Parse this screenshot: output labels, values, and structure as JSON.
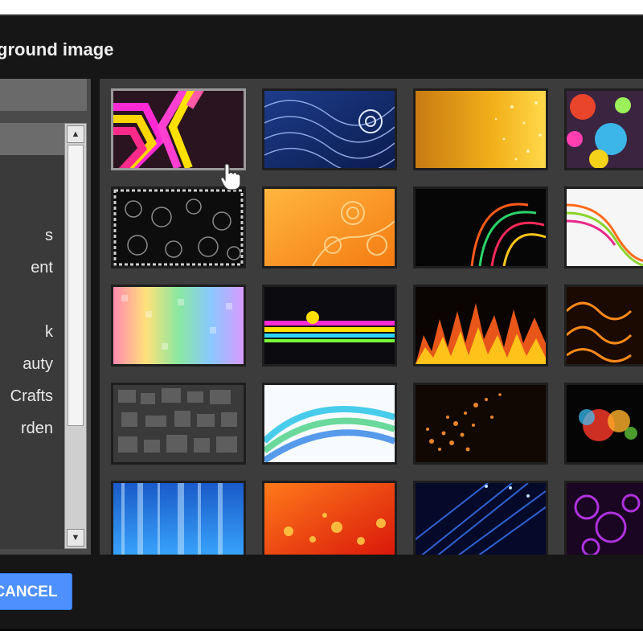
{
  "dialog": {
    "title": "ground image",
    "categories": [
      {
        "label": "",
        "selected": true
      },
      {
        "label": ""
      },
      {
        "label": ""
      },
      {
        "label": "s"
      },
      {
        "label": "ent"
      },
      {
        "label": ""
      },
      {
        "label": "k"
      },
      {
        "label": "auty"
      },
      {
        "label": "Crafts"
      },
      {
        "label": "rden"
      },
      {
        "label": ""
      },
      {
        "label": ""
      },
      {
        "label": ""
      }
    ],
    "cancel_label": "CANCEL"
  },
  "thumbnails": [
    {
      "name": "magenta-neon-stripes"
    },
    {
      "name": "blue-swirl-waves"
    },
    {
      "name": "gold-sparkle"
    },
    {
      "name": "colorful-graffiti"
    },
    {
      "name": "black-white-floral"
    },
    {
      "name": "orange-swirls"
    },
    {
      "name": "light-streaks-dark"
    },
    {
      "name": "rainbow-curves-white"
    },
    {
      "name": "rainbow-mosaic"
    },
    {
      "name": "retro-stripes-dark"
    },
    {
      "name": "flames"
    },
    {
      "name": "fire-smoke"
    },
    {
      "name": "gray-tiles"
    },
    {
      "name": "blue-green-waves"
    },
    {
      "name": "orange-particles"
    },
    {
      "name": "bokeh-lights-dark"
    },
    {
      "name": "blue-light-rays"
    },
    {
      "name": "red-orange-bokeh"
    },
    {
      "name": "blue-fiber-optics"
    },
    {
      "name": "purple-bubbles"
    }
  ],
  "colors": {
    "dialog_bg": "#161616",
    "panel_bg": "#3c3c3c",
    "accent_button": "#4d90fe"
  },
  "icons": {
    "cursor": "pointer-hand-icon",
    "scroll_up": "arrow-up-icon",
    "scroll_down": "arrow-down-icon"
  }
}
